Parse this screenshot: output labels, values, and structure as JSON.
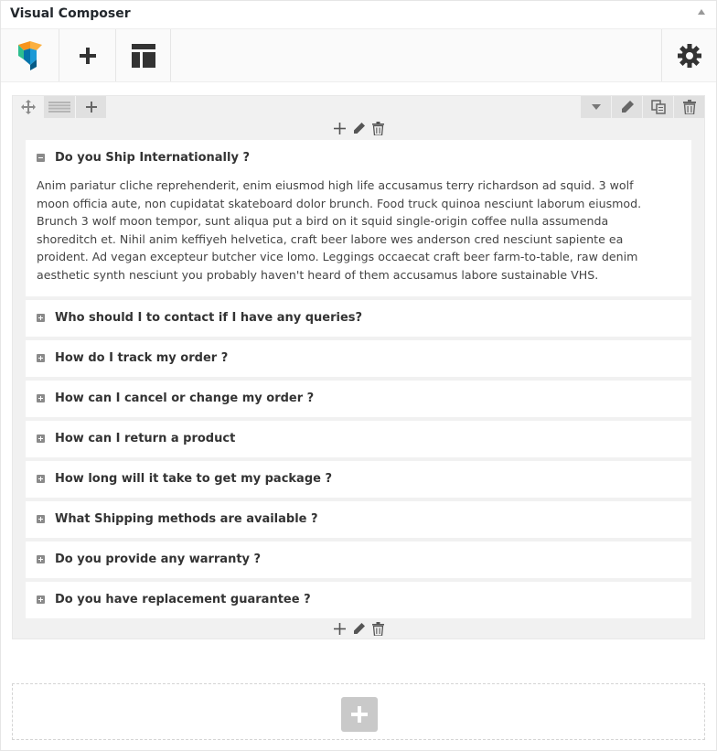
{
  "panel": {
    "title": "Visual Composer",
    "toggle_icon": "triangle-up-icon"
  },
  "toolbar": {
    "logo_icon": "visual-composer-logo",
    "add_icon": "plus-icon",
    "templates_icon": "templates-icon",
    "settings_icon": "gear-icon"
  },
  "colors": {
    "logo_blue": "#0473aa",
    "logo_green": "#2ebe8f",
    "logo_orange": "#f7941d",
    "icon_dark": "#555555",
    "row_bg": "#f1f1f1"
  },
  "accordion": {
    "items": [
      {
        "title": "Do you Ship Internationally ?",
        "expanded": true,
        "body": "Anim pariatur cliche reprehenderit, enim eiusmod high life accusamus terry richardson ad squid. 3 wolf moon officia aute, non cupidatat skateboard dolor brunch. Food truck quinoa nesciunt laborum eiusmod. Brunch 3 wolf moon tempor, sunt aliqua put a bird on it squid single-origin coffee nulla assumenda shoreditch et. Nihil anim keffiyeh helvetica, craft beer labore wes anderson cred nesciunt sapiente ea proident. Ad vegan excepteur butcher vice lomo. Leggings occaecat craft beer farm-to-table, raw denim aesthetic synth nesciunt you probably haven't heard of them accusamus labore sustainable VHS."
      },
      {
        "title": "Who should I to contact if I have any queries?",
        "expanded": false
      },
      {
        "title": "How do I track my order ?",
        "expanded": false
      },
      {
        "title": "How can I cancel or change my order ?",
        "expanded": false
      },
      {
        "title": "How can I return a product",
        "expanded": false
      },
      {
        "title": "How long will it take to get my package ?",
        "expanded": false
      },
      {
        "title": "What Shipping methods are available ?",
        "expanded": false
      },
      {
        "title": "Do you provide any warranty ?",
        "expanded": false
      },
      {
        "title": "Do you have replacement guarantee ?",
        "expanded": false
      }
    ]
  }
}
